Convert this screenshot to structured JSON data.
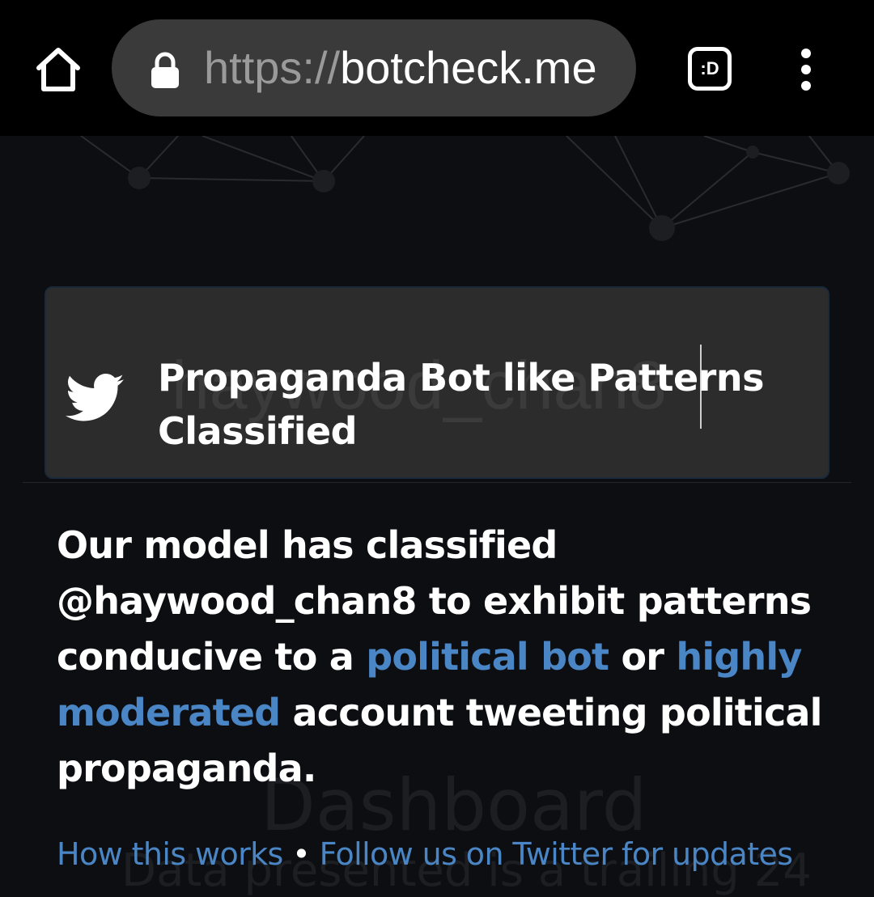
{
  "browser": {
    "url_scheme": "https://",
    "url_host": "botcheck.me",
    "extension_label": ":D",
    "icons": [
      "home-icon",
      "lock-icon",
      "extension-icon",
      "overflow-menu-icon"
    ]
  },
  "background": {
    "input_value": "haywood_chan8",
    "dashboard_title": "Dashboard",
    "dashboard_subtitle": "Data presented is a trailing 24"
  },
  "card": {
    "icon": "twitter-bird-icon",
    "title": "Propaganda Bot like Patterns Classified"
  },
  "message": {
    "part1": "Our model has classified @haywood_chan8 to exhibit patterns conducive to a ",
    "link1": "political bot",
    "part2": " or ",
    "link2": "highly moderated",
    "part3": " account tweeting political propaganda."
  },
  "footer": {
    "how_link": "How this works",
    "separator": "•",
    "follow_link": "Follow us on Twitter for updates"
  },
  "colors": {
    "link": "#4a86c6",
    "card_bg": "#2c2c2c",
    "page_bg": "#0d0e11"
  }
}
